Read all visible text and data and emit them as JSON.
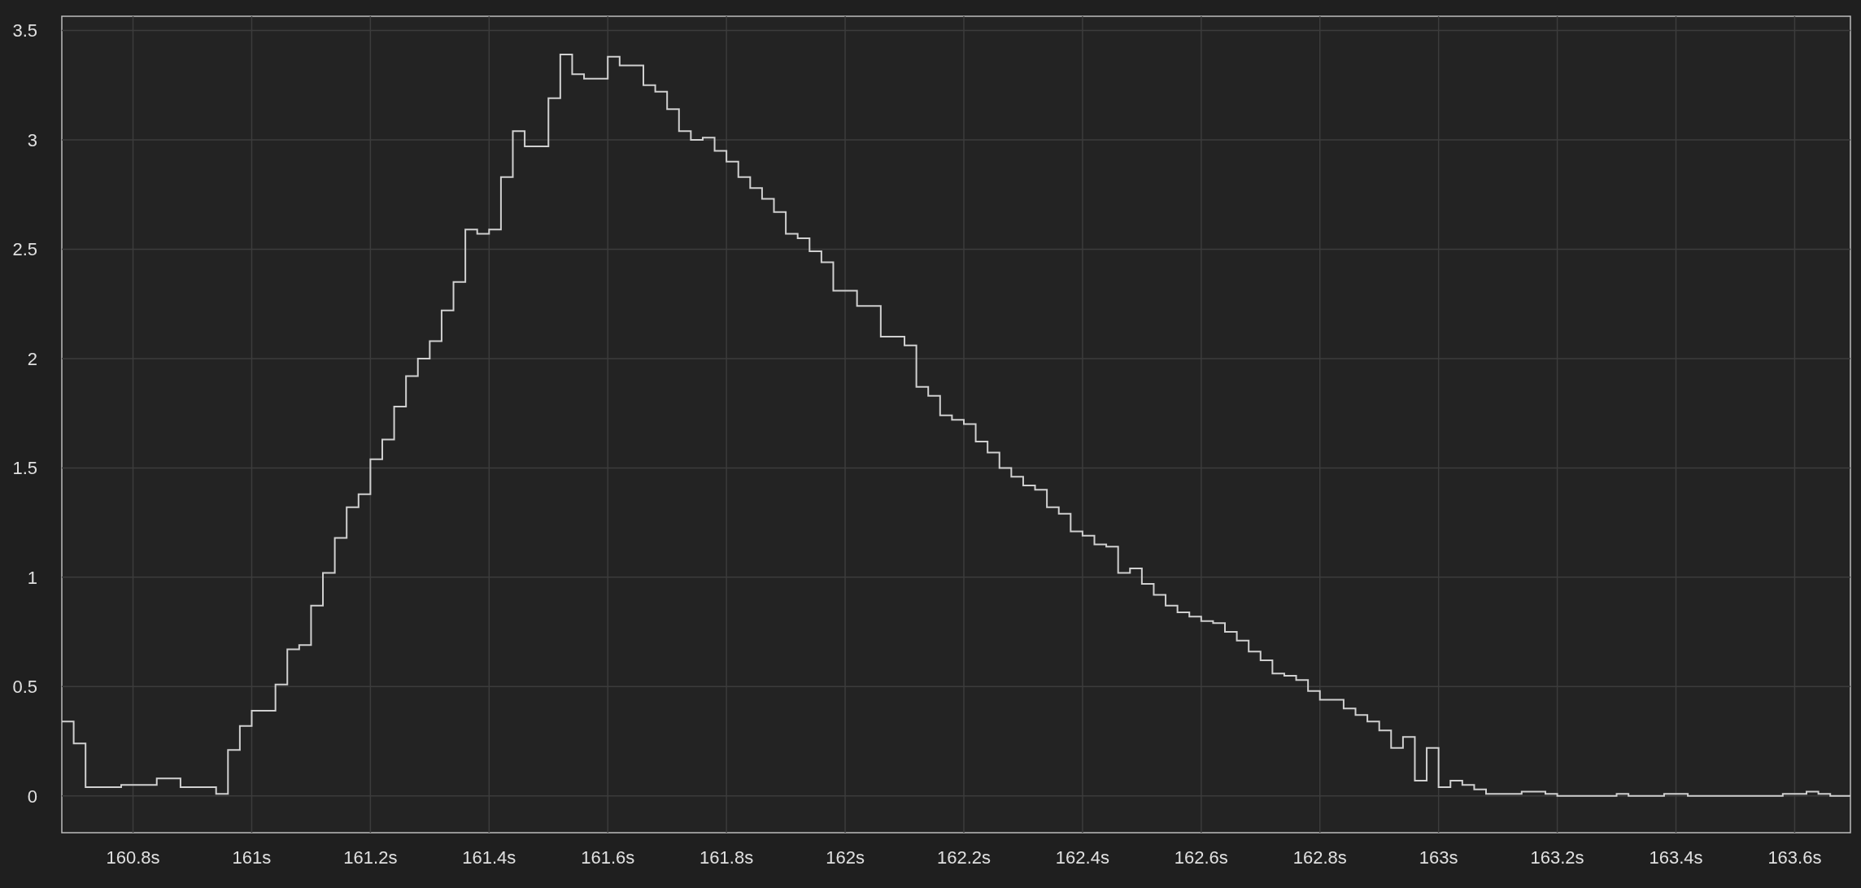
{
  "chart": {
    "chart_data": {
      "type": "line",
      "grid": true,
      "xlim": [
        160.68,
        163.694
      ],
      "ylim": [
        -0.168,
        3.565
      ],
      "xticks": [
        {
          "value": 160.8,
          "label": "160.8s"
        },
        {
          "value": 161,
          "label": "161s"
        },
        {
          "value": 161.2,
          "label": "161.2s"
        },
        {
          "value": 161.4,
          "label": "161.4s"
        },
        {
          "value": 161.6,
          "label": "161.6s"
        },
        {
          "value": 161.8,
          "label": "161.8s"
        },
        {
          "value": 162,
          "label": "162s"
        },
        {
          "value": 162.2,
          "label": "162.2s"
        },
        {
          "value": 162.4,
          "label": "162.4s"
        },
        {
          "value": 162.6,
          "label": "162.6s"
        },
        {
          "value": 162.8,
          "label": "162.8s"
        },
        {
          "value": 163,
          "label": "163s"
        },
        {
          "value": 163.2,
          "label": "163.2s"
        },
        {
          "value": 163.4,
          "label": "163.4s"
        },
        {
          "value": 163.6,
          "label": "163.6s"
        }
      ],
      "yticks": [
        0,
        0.5,
        1,
        1.5,
        2,
        2.5,
        3,
        3.5
      ],
      "x": [
        160.68,
        160.7,
        160.7,
        160.72,
        160.72,
        160.78,
        160.78,
        160.84,
        160.84,
        160.88,
        160.88,
        160.94,
        160.94,
        160.96,
        160.96,
        160.98,
        160.98,
        161,
        161,
        161.04,
        161.04,
        161.06,
        161.06,
        161.08,
        161.08,
        161.1,
        161.1,
        161.12,
        161.12,
        161.14,
        161.14,
        161.16,
        161.16,
        161.18,
        161.18,
        161.2,
        161.2,
        161.22,
        161.22,
        161.24,
        161.24,
        161.26,
        161.26,
        161.28,
        161.28,
        161.3,
        161.3,
        161.32,
        161.32,
        161.34,
        161.34,
        161.36,
        161.36,
        161.38,
        161.38,
        161.4,
        161.4,
        161.42,
        161.42,
        161.44,
        161.44,
        161.46,
        161.46,
        161.5,
        161.5,
        161.52,
        161.52,
        161.54,
        161.54,
        161.56,
        161.56,
        161.6,
        161.6,
        161.62,
        161.62,
        161.66,
        161.66,
        161.68,
        161.68,
        161.7,
        161.7,
        161.72,
        161.72,
        161.74,
        161.74,
        161.76,
        161.76,
        161.78,
        161.78,
        161.8,
        161.8,
        161.82,
        161.82,
        161.84,
        161.84,
        161.86,
        161.86,
        161.88,
        161.88,
        161.9,
        161.9,
        161.92,
        161.92,
        161.94,
        161.94,
        161.96,
        161.96,
        161.98,
        161.98,
        162.02,
        162.02,
        162.06,
        162.06,
        162.1,
        162.1,
        162.12,
        162.12,
        162.14,
        162.14,
        162.16,
        162.16,
        162.18,
        162.18,
        162.2,
        162.2,
        162.22,
        162.22,
        162.24,
        162.24,
        162.26,
        162.26,
        162.28,
        162.28,
        162.3,
        162.3,
        162.32,
        162.32,
        162.34,
        162.34,
        162.36,
        162.36,
        162.38,
        162.38,
        162.4,
        162.4,
        162.42,
        162.42,
        162.44,
        162.44,
        162.46,
        162.46,
        162.48,
        162.48,
        162.5,
        162.5,
        162.52,
        162.52,
        162.54,
        162.54,
        162.56,
        162.56,
        162.58,
        162.58,
        162.6,
        162.6,
        162.62,
        162.62,
        162.64,
        162.64,
        162.66,
        162.66,
        162.68,
        162.68,
        162.7,
        162.7,
        162.72,
        162.72,
        162.74,
        162.74,
        162.76,
        162.76,
        162.78,
        162.78,
        162.8,
        162.8,
        162.84,
        162.84,
        162.86,
        162.86,
        162.88,
        162.88,
        162.9,
        162.9,
        162.92,
        162.92,
        162.94,
        162.94,
        162.96,
        162.96,
        162.98,
        162.98,
        163,
        163,
        163.02,
        163.02,
        163.04,
        163.04,
        163.06,
        163.06,
        163.08,
        163.08,
        163.14,
        163.14,
        163.18,
        163.18,
        163.2,
        163.2,
        163.3,
        163.3,
        163.32,
        163.32,
        163.38,
        163.38,
        163.42,
        163.42,
        163.58,
        163.58,
        163.62,
        163.62,
        163.64,
        163.64,
        163.66,
        163.66,
        163.694
      ],
      "series": [
        {
          "color": "#d0d0d0",
          "values": [
            0.34,
            0.34,
            0.24,
            0.24,
            0.04,
            0.04,
            0.05,
            0.05,
            0.08,
            0.08,
            0.04,
            0.04,
            0.01,
            0.01,
            0.21,
            0.21,
            0.32,
            0.32,
            0.39,
            0.39,
            0.51,
            0.51,
            0.67,
            0.67,
            0.69,
            0.69,
            0.87,
            0.87,
            1.02,
            1.02,
            1.18,
            1.18,
            1.32,
            1.32,
            1.38,
            1.38,
            1.54,
            1.54,
            1.63,
            1.63,
            1.78,
            1.78,
            1.92,
            1.92,
            2.0,
            2.0,
            2.08,
            2.08,
            2.22,
            2.22,
            2.35,
            2.35,
            2.59,
            2.59,
            2.57,
            2.57,
            2.59,
            2.59,
            2.83,
            2.83,
            3.04,
            3.04,
            2.97,
            2.97,
            3.19,
            3.19,
            3.39,
            3.39,
            3.3,
            3.3,
            3.28,
            3.28,
            3.38,
            3.38,
            3.34,
            3.34,
            3.25,
            3.25,
            3.22,
            3.22,
            3.14,
            3.14,
            3.04,
            3.04,
            3.0,
            3.0,
            3.01,
            3.01,
            2.95,
            2.95,
            2.9,
            2.9,
            2.83,
            2.83,
            2.78,
            2.78,
            2.73,
            2.73,
            2.67,
            2.67,
            2.57,
            2.57,
            2.55,
            2.55,
            2.49,
            2.49,
            2.44,
            2.44,
            2.31,
            2.31,
            2.24,
            2.24,
            2.1,
            2.1,
            2.06,
            2.06,
            1.87,
            1.87,
            1.83,
            1.83,
            1.74,
            1.74,
            1.72,
            1.72,
            1.7,
            1.7,
            1.62,
            1.62,
            1.57,
            1.57,
            1.5,
            1.5,
            1.46,
            1.46,
            1.42,
            1.42,
            1.4,
            1.4,
            1.32,
            1.32,
            1.29,
            1.29,
            1.21,
            1.21,
            1.19,
            1.19,
            1.15,
            1.15,
            1.14,
            1.14,
            1.02,
            1.02,
            1.04,
            1.04,
            0.97,
            0.97,
            0.92,
            0.92,
            0.87,
            0.87,
            0.84,
            0.84,
            0.82,
            0.82,
            0.8,
            0.8,
            0.79,
            0.79,
            0.75,
            0.75,
            0.71,
            0.71,
            0.66,
            0.66,
            0.62,
            0.62,
            0.56,
            0.56,
            0.55,
            0.55,
            0.53,
            0.53,
            0.48,
            0.48,
            0.44,
            0.44,
            0.4,
            0.4,
            0.37,
            0.37,
            0.34,
            0.34,
            0.3,
            0.3,
            0.22,
            0.22,
            0.27,
            0.27,
            0.07,
            0.07,
            0.22,
            0.22,
            0.04,
            0.04,
            0.07,
            0.07,
            0.05,
            0.05,
            0.03,
            0.03,
            0.01,
            0.01,
            0.02,
            0.02,
            0.01,
            0.01,
            0,
            0,
            0.01,
            0.01,
            0,
            0,
            0.01,
            0.01,
            0,
            0,
            0.01,
            0.01,
            0.02,
            0.02,
            0.01,
            0.01,
            0,
            0
          ]
        }
      ]
    }
  }
}
